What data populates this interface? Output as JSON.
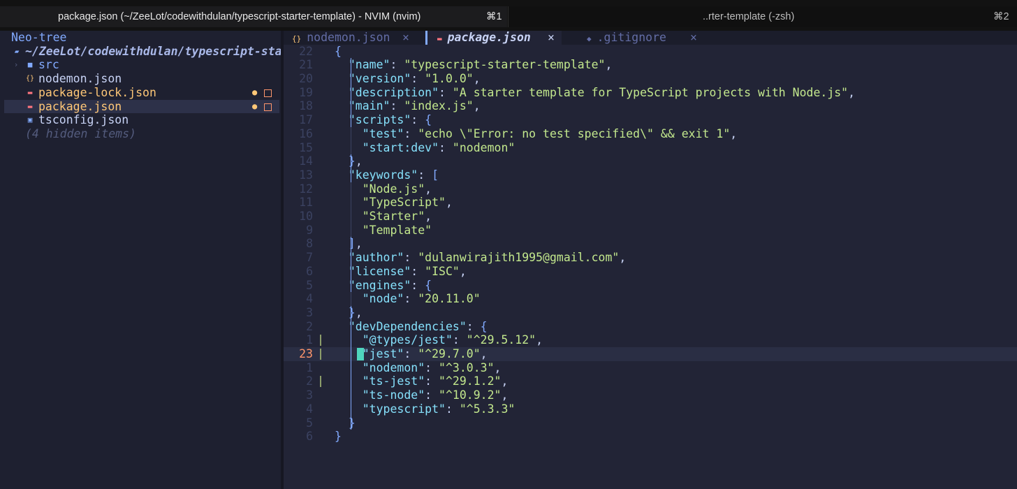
{
  "terminal_tabs": [
    {
      "title": "package.json (~/ZeeLot/codewithdulan/typescript-starter-template) - NVIM (nvim)",
      "shortcut": "⌘1"
    },
    {
      "title": "..rter-template (-zsh)",
      "shortcut": "⌘2"
    }
  ],
  "neotree": {
    "title": "Neo-tree",
    "root": "~/ZeeLot/codewithdulan/typescript-sta",
    "items": [
      {
        "name": "src",
        "icon": "folder-icon",
        "color": "#82aaff",
        "modified": false
      },
      {
        "name": "nodemon.json",
        "icon": "json-icon",
        "color": "#c8d3f5",
        "modified": false
      },
      {
        "name": "package-lock.json",
        "icon": "npm-icon",
        "color": "#ffc777",
        "modified": true
      },
      {
        "name": "package.json",
        "icon": "npm-icon",
        "color": "#ffc777",
        "modified": true
      },
      {
        "name": "tsconfig.json",
        "icon": "typescript-icon",
        "color": "#c8d3f5",
        "modified": false
      }
    ],
    "hidden_label": "(4 hidden items)"
  },
  "bufferline": [
    {
      "name": "nodemon.json",
      "icon": "json-icon",
      "close": "×"
    },
    {
      "name": "package.json",
      "icon": "npm-icon",
      "close": "×",
      "active": true
    },
    {
      "name": ".gitignore",
      "icon": "git-icon",
      "close": "×"
    }
  ],
  "editor": {
    "lines": [
      {
        "num": "22",
        "text": "{"
      },
      {
        "num": "21",
        "text": "  \"name\": \"typescript-starter-template\","
      },
      {
        "num": "20",
        "text": "  \"version\": \"1.0.0\","
      },
      {
        "num": "19",
        "text": "  \"description\": \"A starter template for TypeScript projects with Node.js\","
      },
      {
        "num": "18",
        "text": "  \"main\": \"index.js\","
      },
      {
        "num": "17",
        "text": "  \"scripts\": {"
      },
      {
        "num": "16",
        "text": "    \"test\": \"echo \\\"Error: no test specified\\\" && exit 1\","
      },
      {
        "num": "15",
        "text": "    \"start:dev\": \"nodemon\""
      },
      {
        "num": "14",
        "text": "  },"
      },
      {
        "num": "13",
        "text": "  \"keywords\": ["
      },
      {
        "num": "12",
        "text": "    \"Node.js\","
      },
      {
        "num": "11",
        "text": "    \"TypeScript\","
      },
      {
        "num": "10",
        "text": "    \"Starter\","
      },
      {
        "num": "9",
        "text": "    \"Template\""
      },
      {
        "num": "8",
        "text": "  ],"
      },
      {
        "num": "7",
        "text": "  \"author\": \"dulanwirajith1995@gmail.com\","
      },
      {
        "num": "6",
        "text": "  \"license\": \"ISC\","
      },
      {
        "num": "5",
        "text": "  \"engines\": {"
      },
      {
        "num": "4",
        "text": "    \"node\": \"20.11.0\""
      },
      {
        "num": "3",
        "text": "  },"
      },
      {
        "num": "2",
        "text": "  \"devDependencies\": {"
      },
      {
        "num": "1",
        "text": "    \"@types/jest\": \"^29.5.12\","
      },
      {
        "num": "23",
        "text": "    \"jest\": \"^29.7.0\",",
        "current": true
      },
      {
        "num": "1",
        "text": "    \"nodemon\": \"^3.0.3\","
      },
      {
        "num": "2",
        "text": "    \"ts-jest\": \"^29.1.2\","
      },
      {
        "num": "3",
        "text": "    \"ts-node\": \"^10.9.2\","
      },
      {
        "num": "4",
        "text": "    \"typescript\": \"^5.3.3\""
      },
      {
        "num": "5",
        "text": "  }"
      },
      {
        "num": "6",
        "text": "}"
      }
    ]
  },
  "colors": {
    "key": "#86e1fc",
    "string": "#c3e88d",
    "punct": "#c8d3f5",
    "bracket": "#82aaff",
    "cursor": "#4fd6be"
  }
}
